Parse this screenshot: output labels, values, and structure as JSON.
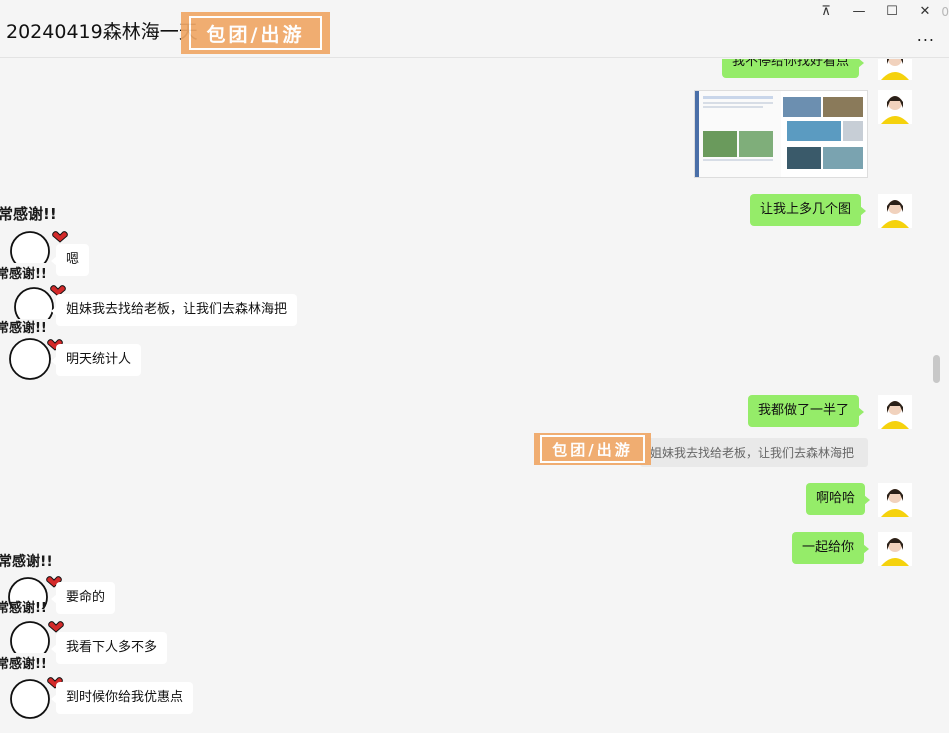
{
  "window": {
    "title": "20240419森林海一天",
    "watermark_text": "包团/出游",
    "controls": {
      "pin": "⊼",
      "minimize": "—",
      "maximize": "☐",
      "close": "✕",
      "more": "..."
    },
    "edge_digit": "0"
  },
  "messages": [
    {
      "side": "out",
      "text": "我不停给你找好看点"
    },
    {
      "side": "out",
      "type": "image"
    },
    {
      "side": "out",
      "text": "让我上多几个图"
    },
    {
      "side": "in",
      "text": "嗯"
    },
    {
      "side": "in",
      "text": "姐妹我去找给老板，让我们去森林海把"
    },
    {
      "side": "in",
      "text": "明天统计人"
    },
    {
      "side": "out",
      "text": "我都做了一半了"
    },
    {
      "side": "out",
      "type": "quote",
      "text": "姐妹我去找给老板，让我们去森林海把"
    },
    {
      "side": "out",
      "text": "啊哈哈"
    },
    {
      "side": "out",
      "text": "一起给你"
    },
    {
      "side": "in",
      "text": "要命的"
    },
    {
      "side": "in",
      "text": "我看下人多不多"
    },
    {
      "side": "in",
      "text": "到时候你给我优惠点"
    }
  ],
  "sticker": {
    "caption": "常感谢!!"
  },
  "colors": {
    "out_bubble": "#95ec69",
    "in_bubble": "#ffffff",
    "background": "#f5f5f5",
    "watermark": "#f0a766"
  }
}
